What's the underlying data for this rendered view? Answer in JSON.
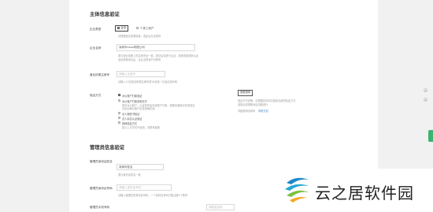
{
  "section1": {
    "title": "主体信息验证",
    "type_label": "企业类型",
    "type_options": [
      "企业",
      "个体工商户"
    ],
    "type_hint": "请根据营业执照选择，选定后无法修改",
    "name_label": "企业名称",
    "name_value": "深圳市xxxx有限公司",
    "name_hint_1": "需与营业执照上的名称完全一致，提交后将进行认证，若修改需重新认证",
    "name_hint_2": "信息审核成功后，企业名称将不可修改",
    "code_label": "营业执照注册号",
    "code_placeholder": "请输入注册号",
    "code_hint": "请输入15位营业执照注册号或18位统一社会信用代码",
    "verify_label": "验证方式",
    "verify_options": [
      "对公账户打款验证",
      "对公账户打款说明文字",
      "法人授权书验证",
      "法人实名认证验证",
      "其他验证方式"
    ],
    "verify_desc": [
      "填写对公账户，认证机构会向该账户打款，按照页面提示完成验证",
      "请务必确认账户信息准确无误",
      "选择此方式需上传法人签字授权书",
      "通过法人身份信息进行验证，需要法人扫码确认",
      "如以上方式均不适用，请联系客服"
    ],
    "badge": "查看说明",
    "side_note_1": "验证方式说明，请根据实际情况选择合适的验证方式",
    "side_note_2": "选择后将按照对应流程进行",
    "side_note_3": "详细说明请参考",
    "side_link": "帮助文档"
  },
  "section2": {
    "title": "管理员信息验证",
    "admin_name_label": "管理员身份证姓名",
    "admin_name_value": "请填写姓名",
    "admin_name_hint": "需与身份证姓名一致",
    "admin_id_label": "管理员身份证号码",
    "admin_id_placeholder": "请输入身份证号码",
    "admin_id_hint": "请输入管理员的身份证号码，一个身份证号码只能注册5个账号",
    "admin_phone_label": "管理员手机号码",
    "admin_phone_placeholder": "获取验证码"
  },
  "watermark": {
    "text": "云之居软件园"
  },
  "colors": {
    "accent": "#4a90c9",
    "side_tab": "#3cb371"
  }
}
